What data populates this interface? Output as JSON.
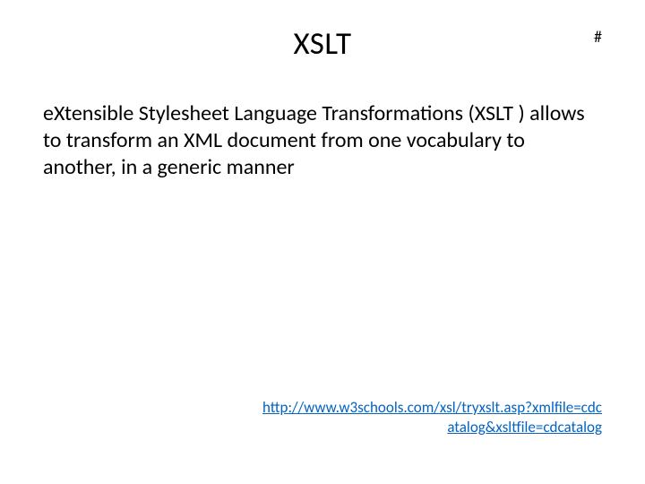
{
  "slide": {
    "number": "#",
    "title": "XSLT",
    "body": "eXtensible Stylesheet Language Transformations (XSLT ) allows to transform an XML document from one vocabulary to another, in a generic manner",
    "link_text": "http://www.w3schools.com/xsl/tryxslt.asp?xmlfile=cdcatalog&xsltfile=cdcatalog",
    "link_href": "http://www.w3schools.com/xsl/tryxslt.asp?xmlfile=cdcatalog&xsltfile=cdcatalog"
  }
}
